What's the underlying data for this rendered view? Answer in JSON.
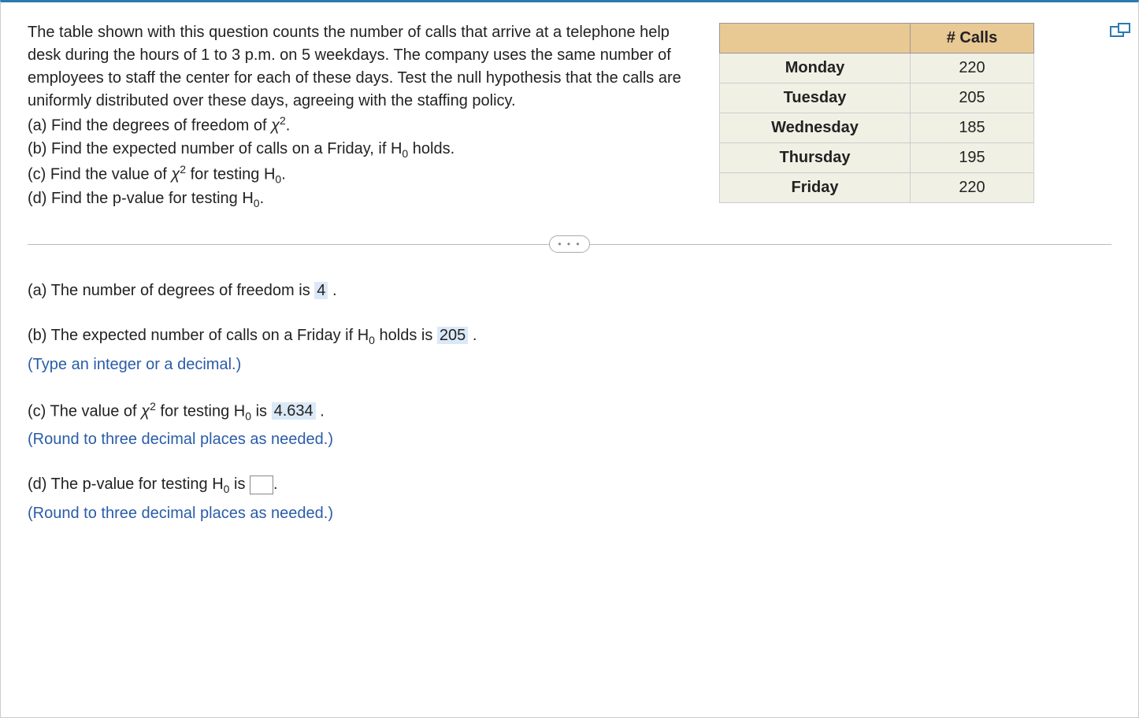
{
  "question": {
    "intro": "The table shown with this question counts the number of calls that arrive at a telephone help desk during the hours of 1 to 3 p.m. on 5 weekdays. The company uses the same number of employees to staff the center for each of these days. Test the null hypothesis that the calls are uniformly distributed over these days, agreeing with the staffing policy.",
    "a": "(a) Find the degrees of freedom of ",
    "a_tail": ".",
    "b_pre": "(b) Find the expected number of calls on a Friday, if H",
    "b_post": " holds.",
    "c_pre": "(c) Find the value of ",
    "c_mid": " for testing H",
    "c_post": ".",
    "d_pre": "(d) Find the p-value for testing H",
    "d_post": "."
  },
  "table": {
    "header_blank": "",
    "header_calls": "# Calls",
    "rows": [
      {
        "day": "Monday",
        "calls": "220"
      },
      {
        "day": "Tuesday",
        "calls": "205"
      },
      {
        "day": "Wednesday",
        "calls": "185"
      },
      {
        "day": "Thursday",
        "calls": "195"
      },
      {
        "day": "Friday",
        "calls": "220"
      }
    ]
  },
  "divider_dots": "• • •",
  "answers": {
    "a_pre": "(a) The number of degrees of freedom is ",
    "a_val": "4",
    "a_post": " .",
    "b_pre": "(b) The expected number of calls on a Friday if H",
    "b_mid": " holds is ",
    "b_val": "205",
    "b_post": " .",
    "b_hint": "(Type an integer or a decimal.)",
    "c_pre": "(c) The value of ",
    "c_mid": " for testing H",
    "c_mid2": " is ",
    "c_val": "4.634",
    "c_post": " .",
    "c_hint": "(Round to three decimal places as needed.)",
    "d_pre": "(d) The p-value for testing H",
    "d_mid": " is ",
    "d_post": ".",
    "d_hint": "(Round to three decimal places as needed.)"
  },
  "symbols": {
    "chi": "χ",
    "sq": "2",
    "zero": "0"
  },
  "chart_data": {
    "type": "table",
    "title": "# Calls",
    "categories": [
      "Monday",
      "Tuesday",
      "Wednesday",
      "Thursday",
      "Friday"
    ],
    "values": [
      220,
      205,
      185,
      195,
      220
    ]
  }
}
